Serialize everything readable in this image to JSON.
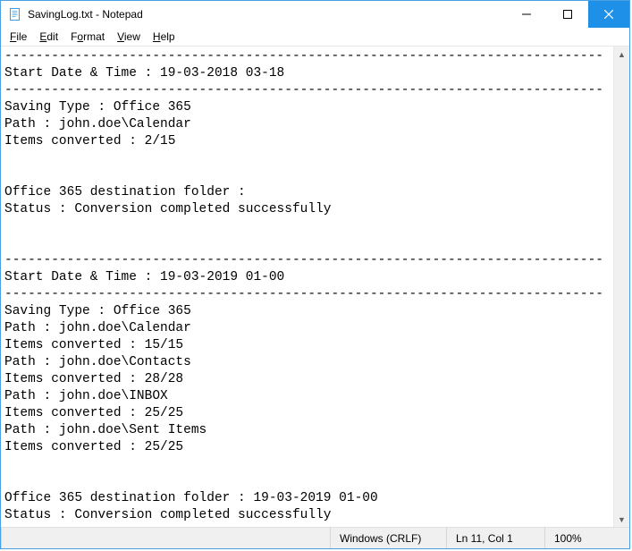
{
  "window": {
    "title": "SavingLog.txt - Notepad"
  },
  "menu": {
    "file": "File",
    "edit": "Edit",
    "format": "Format",
    "view": "View",
    "help": "Help"
  },
  "content": "-----------------------------------------------------------------------------\nStart Date & Time : 19-03-2018 03-18\n-----------------------------------------------------------------------------\nSaving Type : Office 365\nPath : john.doe\\Calendar\nItems converted : 2/15\n\n\nOffice 365 destination folder :\nStatus : Conversion completed successfully\n\n\n-----------------------------------------------------------------------------\nStart Date & Time : 19-03-2019 01-00\n-----------------------------------------------------------------------------\nSaving Type : Office 365\nPath : john.doe\\Calendar\nItems converted : 15/15\nPath : john.doe\\Contacts\nItems converted : 28/28\nPath : john.doe\\INBOX\nItems converted : 25/25\nPath : john.doe\\Sent Items\nItems converted : 25/25\n\n\nOffice 365 destination folder : 19-03-2019 01-00\nStatus : Conversion completed successfully",
  "status": {
    "main": "",
    "encoding": "Windows (CRLF)",
    "position": "Ln 11, Col 1",
    "zoom": "100%"
  }
}
